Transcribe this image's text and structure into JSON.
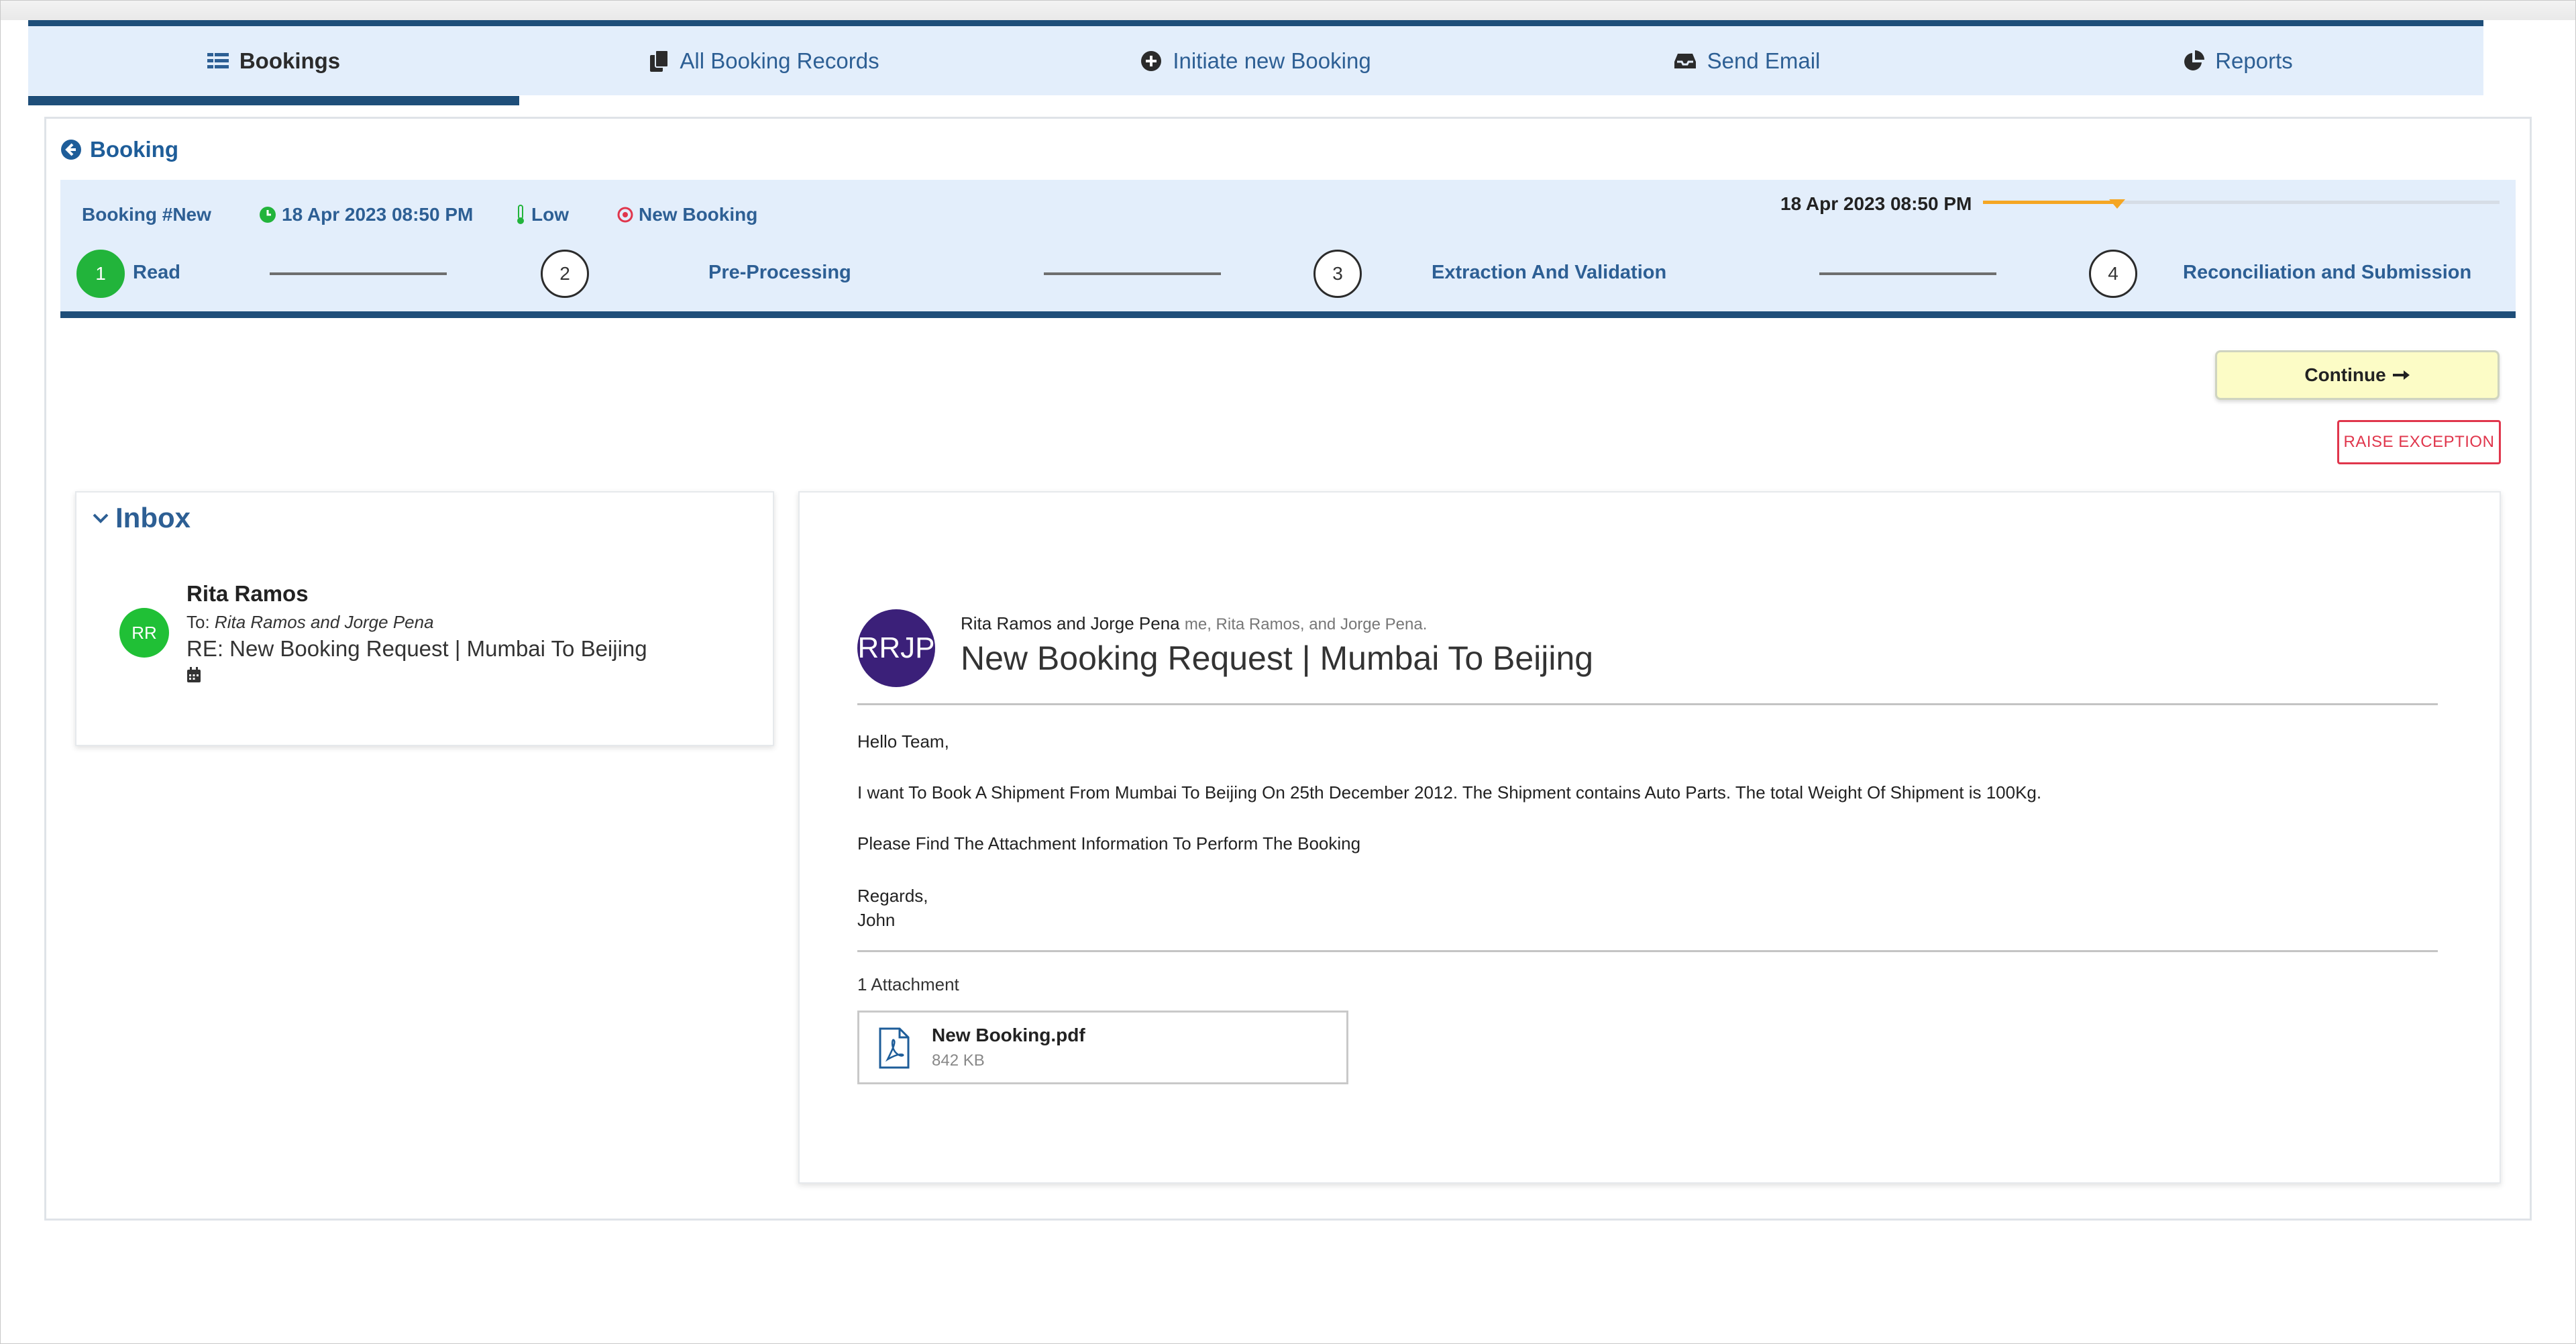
{
  "nav": {
    "tabs": [
      {
        "label": "Bookings",
        "icon": "table-list-icon",
        "active": true
      },
      {
        "label": "All Booking Records",
        "icon": "copy-icon",
        "active": false
      },
      {
        "label": "Initiate new Booking",
        "icon": "plus-circle-icon",
        "active": false
      },
      {
        "label": "Send Email",
        "icon": "inbox-tray-icon",
        "active": false
      },
      {
        "label": "Reports",
        "icon": "pie-chart-icon",
        "active": false
      }
    ]
  },
  "page": {
    "back_label": "Booking"
  },
  "booking": {
    "id_label": "Booking  #New",
    "timestamp": "18 Apr 2023 08:50 PM",
    "priority": "Low",
    "status": "New Booking",
    "deadline_text": "18 Apr 2023 08:50 PM",
    "deadline_progress": 0.26,
    "steps": [
      {
        "number": "1",
        "label": "Read",
        "done": true
      },
      {
        "number": "2",
        "label": "Pre-Processing",
        "done": false
      },
      {
        "number": "3",
        "label": "Extraction And Validation",
        "done": false
      },
      {
        "number": "4",
        "label": "Reconciliation and Submission",
        "done": false
      }
    ]
  },
  "actions": {
    "continue_label": "Continue",
    "raise_label": "RAISE EXCEPTION"
  },
  "inbox": {
    "title": "Inbox",
    "item": {
      "initials": "RR",
      "from": "Rita Ramos",
      "to_prefix": "To:",
      "to_names": "Rita Ramos and Jorge Pena",
      "subject": "RE: New Booking Request | Mumbai To Beijing"
    }
  },
  "email": {
    "avatar_initials": "RRJP",
    "participants": "Rita Ramos and Jorge Pena",
    "cc": "me, Rita Ramos, and Jorge Pena.",
    "subject": "New Booking Request | Mumbai To Beijing",
    "body": {
      "greeting": "Hello Team,",
      "line1": "I want To Book A Shipment From Mumbai To Beijing On 25th December 2012. The Shipment contains Auto Parts. The total Weight Of Shipment is 100Kg.",
      "line2": "Please Find The Attachment Information To Perform The Booking",
      "closing": "Regards,",
      "signature": "John"
    },
    "attachment_count": "1 Attachment",
    "attachment": {
      "name": "New Booking.pdf",
      "size": "842 KB"
    }
  },
  "colors": {
    "nav_bg": "#e3eefb",
    "nav_dark": "#1e4e79",
    "link_blue": "#2d5f94",
    "step_done": "#22b43b",
    "deadline": "#f5a623",
    "exception_red": "#e0364c",
    "continue_bg": "#fcfcc6",
    "email_avatar": "#3b2079",
    "inbox_avatar": "#20c036"
  }
}
